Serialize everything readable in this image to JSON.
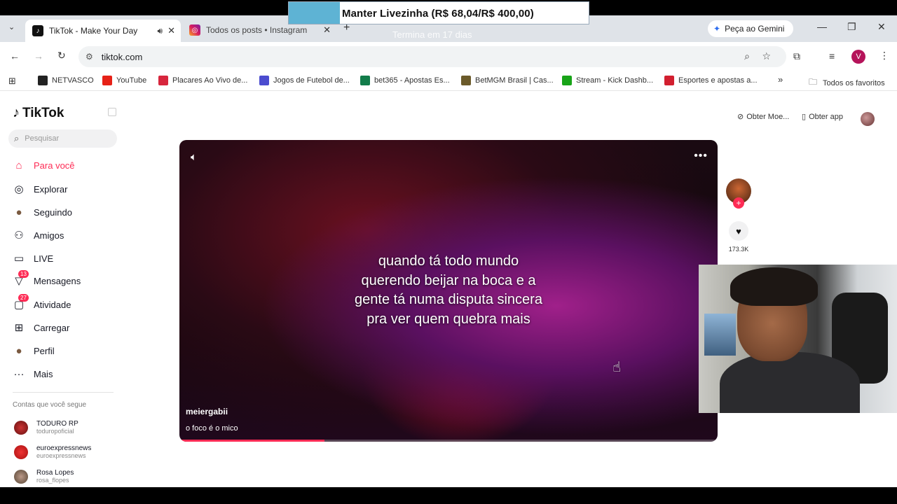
{
  "overlay": {
    "goal_text": "Manter Livezinha (R$ 68,04/R$ 400,00)",
    "goal_progress": 0.17,
    "goal_sub": "Termina em 17 dias",
    "goal_color": "#5eb3d4"
  },
  "browser": {
    "tabs": [
      {
        "title": "TikTok - Make Your Day",
        "icon": "tiktok-icon",
        "active": true
      },
      {
        "title": "Todos os posts • Instagram",
        "icon": "instagram-icon",
        "active": false
      }
    ],
    "gemini_label": "Peça ao Gemini",
    "url": "tiktok.com",
    "profile_initial": "V",
    "bookmarks": [
      {
        "label": "NETVASCO",
        "color": "#222"
      },
      {
        "label": "YouTube",
        "color": "#e62117"
      },
      {
        "label": "Placares Ao Vivo de...",
        "color": "#d7263d"
      },
      {
        "label": "Jogos de Futebol de...",
        "color": "#4b4ccf"
      },
      {
        "label": "bet365 - Apostas Es...",
        "color": "#127c4a"
      },
      {
        "label": "BetMGM Brasil | Cas...",
        "color": "#6b5a2a"
      },
      {
        "label": "Stream - Kick Dashb...",
        "color": "#18a418"
      },
      {
        "label": "Esportes e apostas a...",
        "color": "#d21f2f"
      }
    ],
    "all_favorites": "Todos os favoritos"
  },
  "tiktok": {
    "logo": "TikTok",
    "search_placeholder": "Pesquisar",
    "nav": [
      {
        "label": "Para você",
        "icon": "home-icon",
        "active": true
      },
      {
        "label": "Explorar",
        "icon": "compass-icon"
      },
      {
        "label": "Seguindo",
        "icon": "following-avatar-icon"
      },
      {
        "label": "Amigos",
        "icon": "friends-icon"
      },
      {
        "label": "LIVE",
        "icon": "live-icon"
      },
      {
        "label": "Mensagens",
        "icon": "messages-icon",
        "badge": "13"
      },
      {
        "label": "Atividade",
        "icon": "activity-icon",
        "badge": "27"
      },
      {
        "label": "Carregar",
        "icon": "upload-icon"
      },
      {
        "label": "Perfil",
        "icon": "profile-icon"
      },
      {
        "label": "Mais",
        "icon": "more-icon"
      }
    ],
    "following_header": "Contas que você segue",
    "following": [
      {
        "name": "TODURO RP",
        "handle": "toduropoficial"
      },
      {
        "name": "euroexpressnews",
        "handle": "euroexpressnews"
      },
      {
        "name": "Rosa Lopes",
        "handle": "rosa_flopes"
      }
    ],
    "top_right": {
      "coins": "Obter Moe...",
      "app": "Obter app"
    },
    "video": {
      "caption_lines": [
        "quando tá todo mundo",
        "querendo beijar na boca e a",
        "gente tá numa disputa sincera",
        "pra ver quem quebra mais"
      ],
      "username": "meiergabii",
      "description": "o foco é o mico",
      "progress": 0.27,
      "likes": "173.3K"
    }
  }
}
